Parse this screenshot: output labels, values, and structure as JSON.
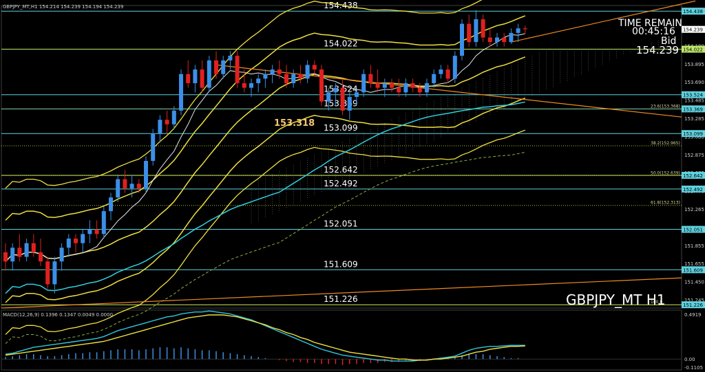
{
  "chart_data": {
    "type": "candlestick",
    "header": "GBPJPY_MT,H1  154.214 154.239 154.194 154.239",
    "symbol_label": "GBPJPY_MT H1",
    "time_remain_label": "TIME REMAIN",
    "time_remain": "00:45:16",
    "bid_label": "Bid",
    "bid": "154.239",
    "price_axis_ticks": [
      "154.305",
      "154.100",
      "153.895",
      "153.690",
      "153.485",
      "153.285",
      "153.080",
      "152.875",
      "152.675",
      "152.470",
      "152.265",
      "152.060",
      "151.855",
      "151.655",
      "151.450",
      "151.245"
    ],
    "axis_badges": [
      {
        "price": 154.438,
        "label": "154.438",
        "color": "#5fd3e0"
      },
      {
        "price": 154.239,
        "label": "154.239",
        "color": "#ffffff"
      },
      {
        "price": 154.022,
        "label": "154.022",
        "color": "#bfe86a"
      },
      {
        "price": 153.524,
        "label": "153.524",
        "color": "#5fd3e0"
      },
      {
        "price": 153.369,
        "label": "153.369",
        "color": "#5fd3e0"
      },
      {
        "price": 153.099,
        "label": "153.099",
        "color": "#5fd3e0"
      },
      {
        "price": 152.642,
        "label": "152.642",
        "color": "#5fd3e0"
      },
      {
        "price": 152.492,
        "label": "152.492",
        "color": "#5fd3e0"
      },
      {
        "price": 152.051,
        "label": "152.051",
        "color": "#5fd3e0"
      },
      {
        "price": 151.609,
        "label": "151.609",
        "color": "#5fd3e0"
      },
      {
        "price": 151.226,
        "label": "151.226",
        "color": "#5fd3e0"
      }
    ],
    "horizontal_levels": [
      {
        "price": 154.438,
        "label": "154.438",
        "color": "#5fd3e0"
      },
      {
        "price": 154.022,
        "label": "154.022",
        "color": "#bfe86a"
      },
      {
        "price": 153.524,
        "label": "153.524",
        "color": "#5fd3e0"
      },
      {
        "price": 153.369,
        "label": "153.369",
        "color": "#5fd3e0"
      },
      {
        "price": 153.099,
        "label": "153.099",
        "color": "#5fd3e0"
      },
      {
        "price": 152.642,
        "label": "152.642",
        "color": "#bfe86a"
      },
      {
        "price": 152.492,
        "label": "152.492",
        "color": "#5fd3e0"
      },
      {
        "price": 152.051,
        "label": "152.051",
        "color": "#5fd3e0"
      },
      {
        "price": 151.609,
        "label": "151.609",
        "color": "#5fd3e0"
      },
      {
        "price": 151.226,
        "label": "151.226",
        "color": "#bfe86a"
      }
    ],
    "fibonacci_levels": [
      {
        "label": "23.6(153.368)",
        "price": 153.368
      },
      {
        "label": "38.2(152.965)",
        "price": 152.965
      },
      {
        "label": "50.0(152.639)",
        "price": 152.639
      },
      {
        "label": "61.8(152.313)",
        "price": 152.313
      },
      {
        "label": "100.0",
        "price": 151.226
      }
    ],
    "highlight_label": "153.318",
    "highlight_label_color": "#f5c870",
    "macd_label": "MACD(12,26,9) 0.1396 0.1347 0.0049 0.0000",
    "macd_axis_ticks": [
      "0.4919",
      "0.00",
      "-0.1105"
    ],
    "candles": [
      [
        151.8,
        151.9,
        151.6,
        151.7
      ],
      [
        151.7,
        151.9,
        151.6,
        151.85
      ],
      [
        151.85,
        152.0,
        151.7,
        151.75
      ],
      [
        151.75,
        151.95,
        151.7,
        151.9
      ],
      [
        151.9,
        152.0,
        151.75,
        151.8
      ],
      [
        151.8,
        151.95,
        151.65,
        151.7
      ],
      [
        151.7,
        151.75,
        151.4,
        151.45
      ],
      [
        151.45,
        151.75,
        151.35,
        151.7
      ],
      [
        151.7,
        151.9,
        151.6,
        151.85
      ],
      [
        151.85,
        152.0,
        151.75,
        151.95
      ],
      [
        151.95,
        152.0,
        151.8,
        151.9
      ],
      [
        151.9,
        152.05,
        151.8,
        152.0
      ],
      [
        152.0,
        152.15,
        151.9,
        152.05
      ],
      [
        152.05,
        152.15,
        151.95,
        152.0
      ],
      [
        152.0,
        152.3,
        151.95,
        152.25
      ],
      [
        152.25,
        152.45,
        152.15,
        152.4
      ],
      [
        152.4,
        152.65,
        152.35,
        152.6
      ],
      [
        152.6,
        152.7,
        152.45,
        152.5
      ],
      [
        152.5,
        152.65,
        152.4,
        152.55
      ],
      [
        152.55,
        152.6,
        152.45,
        152.5
      ],
      [
        152.5,
        152.85,
        152.45,
        152.8
      ],
      [
        152.8,
        153.15,
        152.75,
        153.1
      ],
      [
        153.1,
        153.3,
        153.0,
        153.25
      ],
      [
        153.25,
        153.35,
        153.1,
        153.2
      ],
      [
        153.2,
        153.4,
        153.15,
        153.35
      ],
      [
        153.35,
        153.8,
        153.3,
        153.75
      ],
      [
        153.75,
        153.9,
        153.6,
        153.65
      ],
      [
        153.65,
        153.85,
        153.55,
        153.8
      ],
      [
        153.8,
        153.9,
        153.55,
        153.6
      ],
      [
        153.6,
        153.95,
        153.55,
        153.9
      ],
      [
        153.9,
        154.0,
        153.7,
        153.75
      ],
      [
        153.75,
        153.95,
        153.7,
        153.9
      ],
      [
        153.9,
        154.0,
        153.8,
        153.95
      ],
      [
        153.95,
        154.0,
        153.6,
        153.65
      ],
      [
        153.65,
        153.8,
        153.55,
        153.6
      ],
      [
        153.6,
        153.7,
        153.5,
        153.65
      ],
      [
        153.65,
        153.75,
        153.55,
        153.7
      ],
      [
        153.7,
        153.8,
        153.6,
        153.75
      ],
      [
        153.75,
        153.85,
        153.65,
        153.8
      ],
      [
        153.8,
        153.9,
        153.7,
        153.75
      ],
      [
        153.75,
        153.85,
        153.6,
        153.65
      ],
      [
        153.65,
        153.8,
        153.6,
        153.75
      ],
      [
        153.75,
        153.85,
        153.65,
        153.7
      ],
      [
        153.7,
        153.9,
        153.65,
        153.85
      ],
      [
        153.85,
        153.9,
        153.75,
        153.8
      ],
      [
        153.8,
        153.85,
        153.4,
        153.45
      ],
      [
        153.45,
        153.6,
        153.35,
        153.55
      ],
      [
        153.55,
        153.65,
        153.4,
        153.6
      ],
      [
        153.6,
        153.7,
        153.3,
        153.35
      ],
      [
        153.35,
        153.55,
        153.25,
        153.5
      ],
      [
        153.5,
        153.6,
        153.4,
        153.55
      ],
      [
        153.55,
        153.8,
        153.5,
        153.75
      ],
      [
        153.75,
        153.85,
        153.6,
        153.65
      ],
      [
        153.65,
        153.8,
        153.55,
        153.6
      ],
      [
        153.6,
        153.7,
        153.5,
        153.65
      ],
      [
        153.65,
        153.7,
        153.55,
        153.6
      ],
      [
        153.6,
        153.7,
        153.5,
        153.55
      ],
      [
        153.55,
        153.7,
        153.5,
        153.65
      ],
      [
        153.65,
        153.7,
        153.55,
        153.6
      ],
      [
        153.6,
        153.65,
        153.5,
        153.55
      ],
      [
        153.55,
        153.7,
        153.5,
        153.65
      ],
      [
        153.65,
        153.8,
        153.6,
        153.75
      ],
      [
        153.75,
        153.85,
        153.7,
        153.8
      ],
      [
        153.8,
        153.85,
        153.65,
        153.7
      ],
      [
        153.7,
        154.0,
        153.65,
        153.95
      ],
      [
        153.95,
        154.35,
        153.9,
        154.3
      ],
      [
        154.3,
        154.4,
        154.05,
        154.1
      ],
      [
        154.1,
        154.45,
        154.05,
        154.35
      ],
      [
        154.35,
        154.4,
        154.1,
        154.15
      ],
      [
        154.15,
        154.25,
        154.05,
        154.1
      ],
      [
        154.1,
        154.2,
        154.05,
        154.15
      ],
      [
        154.15,
        154.2,
        154.05,
        154.1
      ],
      [
        154.1,
        154.25,
        154.08,
        154.2
      ],
      [
        154.2,
        154.3,
        154.1,
        154.25
      ],
      [
        154.25,
        154.28,
        154.19,
        154.24
      ]
    ],
    "macd_histogram": [
      0.02,
      0.03,
      0.04,
      0.05,
      0.05,
      0.04,
      0.03,
      0.03,
      0.04,
      0.05,
      0.06,
      0.06,
      0.07,
      0.07,
      0.08,
      0.09,
      0.1,
      0.1,
      0.1,
      0.09,
      0.1,
      0.11,
      0.12,
      0.12,
      0.11,
      0.12,
      0.11,
      0.1,
      0.09,
      0.09,
      0.08,
      0.07,
      0.06,
      0.05,
      0.04,
      0.03,
      0.02,
      0.01,
      0.0,
      -0.01,
      -0.02,
      -0.03,
      -0.03,
      -0.04,
      -0.04,
      -0.05,
      -0.05,
      -0.05,
      -0.06,
      -0.05,
      -0.05,
      -0.04,
      -0.04,
      -0.04,
      -0.03,
      -0.03,
      -0.03,
      -0.02,
      -0.02,
      -0.02,
      -0.01,
      -0.01,
      0.0,
      0.01,
      0.02,
      0.04,
      0.05,
      0.05,
      0.05,
      0.04,
      0.03,
      0.02,
      0.01,
      0.01,
      0.0
    ],
    "macd_line": [
      0.05,
      0.06,
      0.08,
      0.1,
      0.12,
      0.13,
      0.14,
      0.15,
      0.16,
      0.17,
      0.18,
      0.19,
      0.2,
      0.21,
      0.23,
      0.26,
      0.29,
      0.31,
      0.33,
      0.35,
      0.37,
      0.39,
      0.41,
      0.43,
      0.44,
      0.46,
      0.47,
      0.48,
      0.48,
      0.49,
      0.48,
      0.47,
      0.46,
      0.44,
      0.42,
      0.4,
      0.37,
      0.34,
      0.31,
      0.28,
      0.25,
      0.22,
      0.19,
      0.16,
      0.13,
      0.1,
      0.08,
      0.06,
      0.04,
      0.03,
      0.02,
      0.01,
      0.0,
      -0.01,
      -0.01,
      -0.02,
      -0.02,
      -0.02,
      -0.02,
      -0.01,
      -0.01,
      0.0,
      0.01,
      0.02,
      0.03,
      0.06,
      0.09,
      0.11,
      0.12,
      0.13,
      0.13,
      0.135,
      0.14,
      0.14,
      0.14
    ],
    "macd_signal": [
      0.04,
      0.05,
      0.06,
      0.07,
      0.08,
      0.09,
      0.1,
      0.11,
      0.12,
      0.13,
      0.14,
      0.15,
      0.16,
      0.17,
      0.18,
      0.2,
      0.22,
      0.24,
      0.26,
      0.28,
      0.3,
      0.32,
      0.34,
      0.36,
      0.38,
      0.4,
      0.42,
      0.43,
      0.44,
      0.45,
      0.45,
      0.45,
      0.44,
      0.43,
      0.41,
      0.39,
      0.37,
      0.35,
      0.32,
      0.3,
      0.27,
      0.25,
      0.22,
      0.2,
      0.17,
      0.15,
      0.13,
      0.11,
      0.09,
      0.07,
      0.06,
      0.05,
      0.04,
      0.03,
      0.02,
      0.01,
      0.0,
      0.0,
      -0.01,
      -0.01,
      -0.01,
      0.0,
      0.0,
      0.01,
      0.02,
      0.03,
      0.05,
      0.07,
      0.08,
      0.1,
      0.11,
      0.12,
      0.13,
      0.13,
      0.135
    ]
  }
}
